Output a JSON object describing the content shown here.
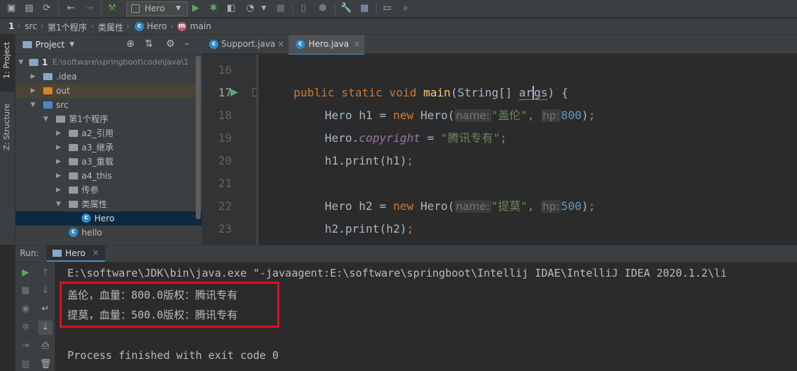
{
  "toolbar": {
    "run_config": "Hero",
    "icons": [
      "save-icon",
      "save-all-icon",
      "sync-icon",
      "back-icon",
      "forward-icon",
      "build-icon",
      "run-icon",
      "debug-icon",
      "coverage-icon",
      "profile-icon",
      "stop-icon",
      "device-icon",
      "settings-icon",
      "project-structure-icon",
      "terminal-icon",
      "search-icon"
    ]
  },
  "breadcrumb": {
    "items": [
      "1",
      "src",
      "第1个程序",
      "类属性",
      "Hero",
      "main"
    ]
  },
  "left_strip": {
    "project_tab": "1: Project",
    "structure_tab": "Z: Structure"
  },
  "project_panel": {
    "title": "Project",
    "tree": [
      {
        "label": "1",
        "path": "E:\\software\\springboot\\code\\java\\1",
        "indent": 0,
        "expanded": true,
        "type": "module"
      },
      {
        "label": ".idea",
        "indent": 1,
        "expanded": false,
        "type": "folder"
      },
      {
        "label": "out",
        "indent": 1,
        "expanded": false,
        "type": "folder-out"
      },
      {
        "label": "src",
        "indent": 1,
        "expanded": true,
        "type": "folder-src"
      },
      {
        "label": "第1个程序",
        "indent": 2,
        "expanded": true,
        "type": "package"
      },
      {
        "label": "a2_引用",
        "indent": 3,
        "expanded": false,
        "type": "package"
      },
      {
        "label": "a3_继承",
        "indent": 3,
        "expanded": false,
        "type": "package"
      },
      {
        "label": "a3_重载",
        "indent": 3,
        "expanded": false,
        "type": "package"
      },
      {
        "label": "a4_this",
        "indent": 3,
        "expanded": false,
        "type": "package"
      },
      {
        "label": "传参",
        "indent": 3,
        "expanded": false,
        "type": "package"
      },
      {
        "label": "类属性",
        "indent": 3,
        "expanded": true,
        "type": "package"
      },
      {
        "label": "Hero",
        "indent": 4,
        "type": "class",
        "selected": true
      },
      {
        "label": "hello",
        "indent": 3,
        "type": "class"
      }
    ]
  },
  "editor_tabs": [
    {
      "label": "Support.java",
      "active": false
    },
    {
      "label": "Hero.java",
      "active": true
    }
  ],
  "editor": {
    "line_numbers": [
      "16",
      "17",
      "18",
      "19",
      "20",
      "21",
      "22",
      "23"
    ],
    "hint_name": "name:",
    "hint_hp": "hp:",
    "str_gailun": "\"盖伦\"",
    "str_copyright": "\"腾讯专有\"",
    "str_timo": "\"提莫\"",
    "num_800": "800",
    "num_500": "500"
  },
  "run_panel": {
    "label": "Run:",
    "tab": "Hero",
    "lines": [
      "E:\\software\\JDK\\bin\\java.exe \"-javaagent:E:\\software\\springboot\\Intellij IDAE\\IntelliJ IDEA 2020.1.2\\li",
      "盖伦，血量：800.0版权：腾讯专有",
      "提莫，血量：500.0版权：腾讯专有",
      "",
      "Process finished with exit code 0"
    ]
  },
  "colors": {
    "highlight_box": "#e0101b",
    "accent": "#4a88c7"
  }
}
